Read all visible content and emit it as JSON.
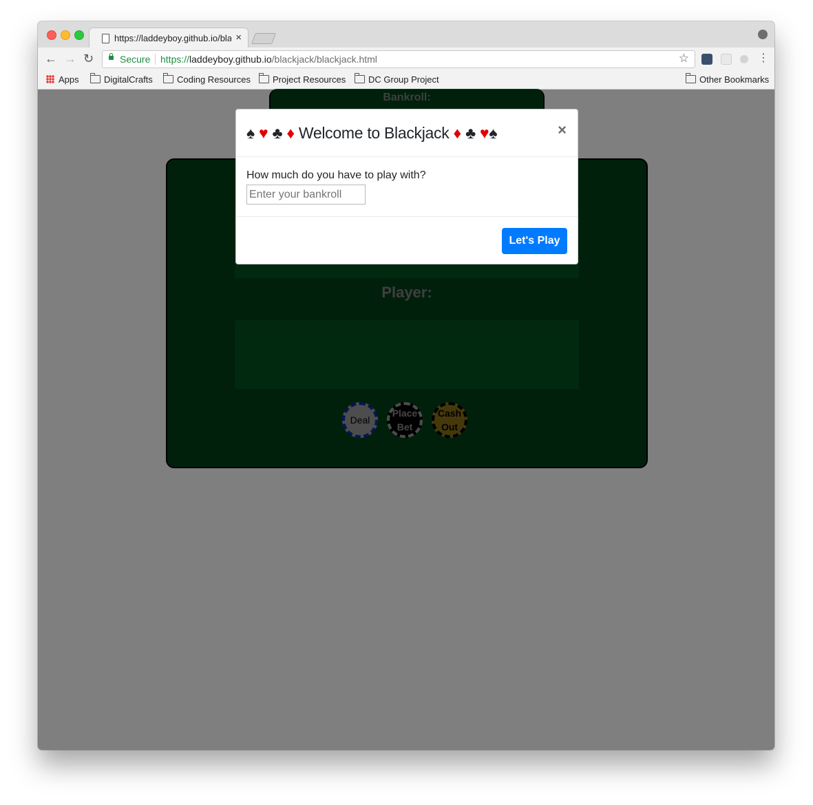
{
  "browser": {
    "tab_title": "https://laddeyboy.github.io/blackjack",
    "tab_close": "×",
    "secure_label": "Secure",
    "url_scheme": "https://",
    "url_host": "laddeyboy.github.io",
    "url_path": "/blackjack/blackjack.html",
    "bookmarks": {
      "apps": "Apps",
      "items": [
        "DigitalCrafts",
        "Coding Resources",
        "Project Resources",
        "DC Group Project"
      ],
      "other": "Other Bookmarks"
    }
  },
  "game": {
    "bankroll_label": "Bankroll:",
    "player_label": "Player:",
    "chips": {
      "deal": "Deal",
      "place_bet_1": "Place",
      "place_bet_2": "Bet",
      "cash_out_1": "Cash",
      "cash_out_2": "Out"
    }
  },
  "modal": {
    "suits_left": [
      "♠",
      "♥",
      "♣",
      "♦"
    ],
    "title": "Welcome to Blackjack",
    "suits_right": [
      "♦",
      "♣",
      "♥",
      "♠"
    ],
    "close": "×",
    "prompt": "How much do you have to play with?",
    "input_placeholder": "Enter your bankroll",
    "button_label": "Let's Play"
  },
  "colors": {
    "felt": "#014019",
    "felt_area": "#025220",
    "primary_button": "#007bff",
    "suit_red": "#e00000"
  }
}
